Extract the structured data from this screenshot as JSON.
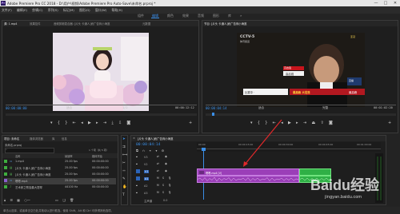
{
  "app": {
    "title": "Adobe Premiere Pro CC 2018 - D:\\用户\\视频\\Adobe Premiere Pro Auto-Save\\未命名.prproj *",
    "logo": "Pr",
    "window_buttons": [
      "—",
      "□",
      "✕"
    ]
  },
  "menu": [
    "文件(F)",
    "编辑(E)",
    "剪辑(C)",
    "序列(S)",
    "标记(M)",
    "图形(G)",
    "窗口(W)",
    "帮助(H)"
  ],
  "workspaces": [
    {
      "label": "组件",
      "active": false
    },
    {
      "label": "编辑",
      "active": true
    },
    {
      "label": "颜色",
      "active": false
    },
    {
      "label": "效果",
      "active": false
    },
    {
      "label": "音频",
      "active": false
    },
    {
      "label": "图形",
      "active": false
    },
    {
      "label": "库",
      "active": false
    }
  ],
  "source_monitor": {
    "tabs": [
      "源: 1.mp4",
      "效果控件",
      "音频剪辑混合器: [片头 卡通人]而广告商小海遂",
      "元数据"
    ],
    "timecode_left": "00:00:00:00",
    "timecode_right": "00:00:12:12",
    "zoom": "适合",
    "resolution": "1/2"
  },
  "program_monitor": {
    "tab": "节目: [片头 卡通人]而广告商小海遂",
    "timecode_left": "00:00:04:14",
    "timecode_right": "00:01:02:20",
    "zoom": "适合",
    "resolution": "完整",
    "overlay": {
      "channel_logo": "CCTV-5",
      "channel_sub": "体育频道",
      "live_badge": "直播",
      "tag_red": "高启强",
      "name_bar": "高启强",
      "score_bottom": "大坦荡",
      "badge_small": "亚冠",
      "ticker_left": "比赛中 ·",
      "ticker_right": "最高峰",
      "bottom_title": "最高峰 大坦荡"
    }
  },
  "project_panel": {
    "tabs": [
      "项目: 未命名",
      "媒体浏览器",
      "库",
      "信息"
    ],
    "file": "未命名.prproj",
    "search_placeholder": "",
    "count": "1 个项（共 5 项）",
    "columns": [
      "名称",
      "帧速率",
      "媒体开始"
    ],
    "items": [
      {
        "name": "1.mp4",
        "fps": "25.00 fps",
        "start": "00:00:00:00",
        "color": "#3fae3f"
      },
      {
        "name": "[片头 卡通人]而广告商小海遂",
        "fps": "25.00 fps",
        "start": "00:00:00:00",
        "color": "#3fae3f"
      },
      {
        "name": "[片头 卡通人]而广告商小海遂",
        "fps": "25.00 fps",
        "start": "00:00:00:00",
        "color": "#3fae3f"
      },
      {
        "name": "嗯嗯.mp4",
        "fps": "25.00 fps",
        "start": "00:00:00:00",
        "color": "#8a5ecf"
      },
      {
        "name": "艺术家之歌独奏大提琴",
        "fps": "44100 Hz",
        "start": "00:00:00:00",
        "color": "#3fae3f"
      }
    ]
  },
  "timeline": {
    "tab": "[片头 卡通人]而广告商小海遂",
    "timecode": "00:00:04:14",
    "ruler_labels": [
      "00:00",
      "00:00:15:00",
      "00:00:30:00",
      "00:00:45:00",
      "00:01:00:00"
    ],
    "tracks": [
      {
        "name": "V3"
      },
      {
        "name": "V2"
      },
      {
        "name": "V1",
        "clip": "嗯嗯.mp4 [V]"
      },
      {
        "name": "A1"
      },
      {
        "name": "A2"
      },
      {
        "name": "A3"
      },
      {
        "name": "主声道",
        "value": "0.0"
      }
    ],
    "playhead_fraction": 0.08
  },
  "status_bar": {
    "text": "单击以选择，或者单击空白处并拖动以进行框选。使用 Shift、Alt 和 Ctrl 可获得其他选项。"
  },
  "watermark": {
    "brand": "Baidu经验",
    "url": "jingyan.baidu.com"
  }
}
